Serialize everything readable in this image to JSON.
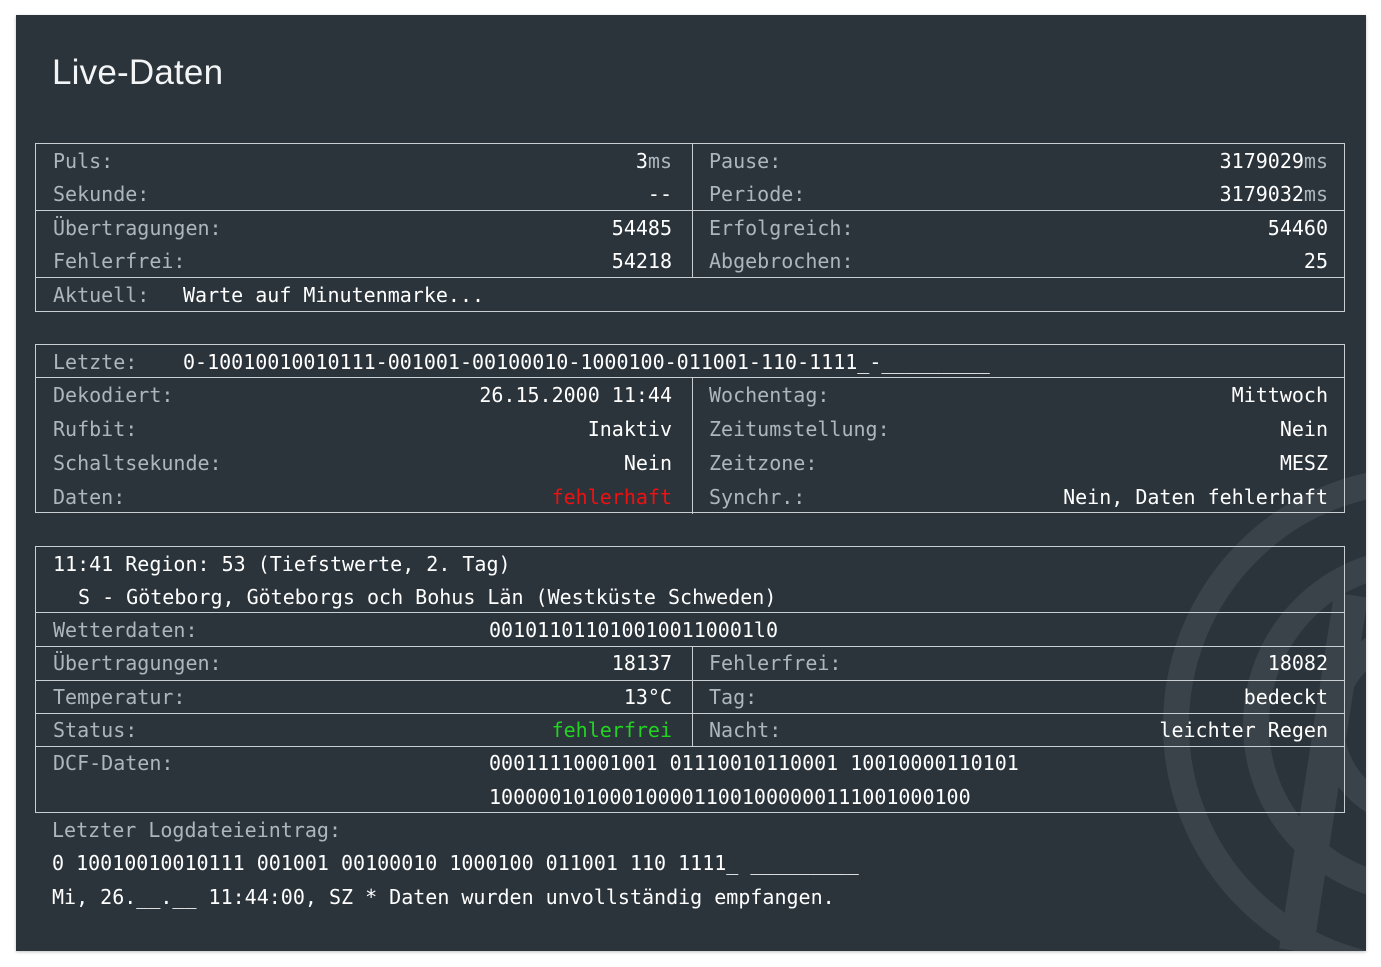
{
  "title": "Live-Daten",
  "colors": {
    "panel": "#2b343b",
    "label": "#aeb6bd",
    "value": "#ffffff",
    "error": "#ee1111",
    "ok": "#22d322",
    "border": "#c9ced2"
  },
  "icons": {
    "watermark": "radio-signal-icon"
  },
  "status": {
    "pulse_label": "Puls:",
    "pulse_value": "3",
    "pulse_unit": "ms",
    "pause_label": "Pause:",
    "pause_value": "3179029",
    "pause_unit": "ms",
    "second_label": "Sekunde:",
    "second_value": "--",
    "period_label": "Periode:",
    "period_value": "3179032",
    "period_unit": "ms",
    "transmissions_label": "Übertragungen:",
    "transmissions_value": "54485",
    "successful_label": "Erfolgreich:",
    "successful_value": "54460",
    "errorfree_label": "Fehlerfrei:",
    "errorfree_value": "54218",
    "aborted_label": "Abgebrochen:",
    "aborted_value": "25",
    "current_label": "Aktuell:",
    "current_value": "Warte auf Minutenmarke..."
  },
  "decode": {
    "last_label": "Letzte:",
    "last_value": "0-10010010010111-001001-00100010-1000100-011001-110-1111_-_________",
    "decoded_label": "Dekodiert:",
    "decoded_value": "26.15.2000 11:44",
    "weekday_label": "Wochentag:",
    "weekday_value": "Mittwoch",
    "callbit_label": "Rufbit:",
    "callbit_value": "Inaktiv",
    "dst_label": "Zeitumstellung:",
    "dst_value": "Nein",
    "leap_label": "Schaltsekunde:",
    "leap_value": "Nein",
    "timezone_label": "Zeitzone:",
    "timezone_value": "MESZ",
    "data_label": "Daten:",
    "data_value": "fehlerhaft",
    "sync_label": "Synchr.:",
    "sync_value": "Nein, Daten fehlerhaft"
  },
  "weather": {
    "header_line1": "11:41 Region: 53 (Tiefstwerte, 2. Tag)",
    "header_line2": "S - Göteborg, Göteborgs och Bohus Län (Westküste Schweden)",
    "weatherdata_label": "Wetterdaten:",
    "weatherdata_value": "0010110110100100110001l0",
    "transmissions_label": "Übertragungen:",
    "transmissions_value": "18137",
    "errorfree_label": "Fehlerfrei:",
    "errorfree_value": "18082",
    "temperature_label": "Temperatur:",
    "temperature_value": "13°C",
    "day_label": "Tag:",
    "day_value": "bedeckt",
    "status_label": "Status:",
    "status_value": "fehlerfrei",
    "night_label": "Nacht:",
    "night_value": "leichter Regen",
    "dcf_label": "DCF-Daten:",
    "dcf_line1": "00011110001001 01110010110001 10010000110101",
    "dcf_line2": "1000001010001000011001000000111001000100"
  },
  "log": {
    "label": "Letzter Logdateieintrag:",
    "line1": "0 10010010010111 001001 00100010 1000100 011001 110 1111_ _________",
    "line2": "Mi, 26.__.__ 11:44:00, SZ * Daten wurden unvollständig empfangen."
  }
}
